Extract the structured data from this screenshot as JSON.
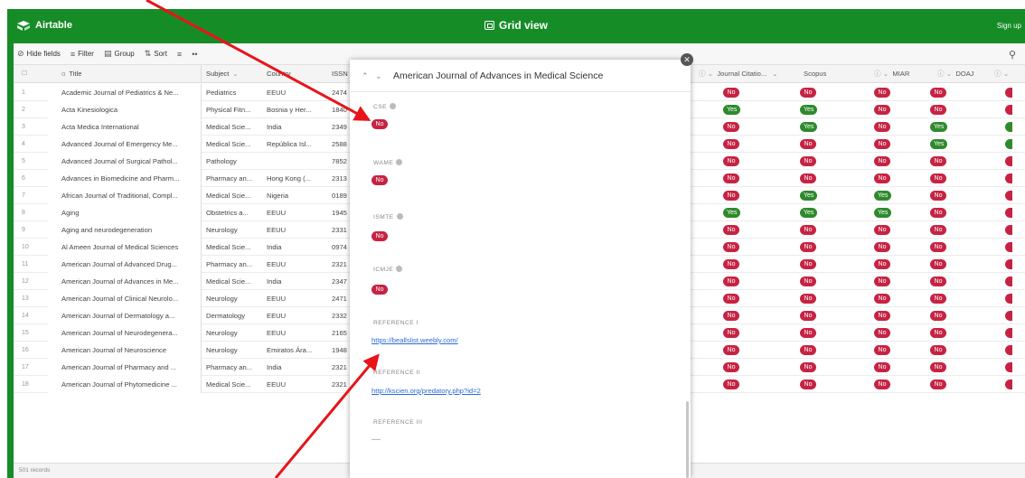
{
  "app": {
    "brand": "Airtable",
    "view_title": "Grid view",
    "signup": "Sign up"
  },
  "toolbar": {
    "hide_fields": "Hide fields",
    "filter": "Filter",
    "group": "Group",
    "sort": "Sort",
    "more": "≡",
    "ellipsis": "••"
  },
  "grid": {
    "headers": {
      "title": "Title",
      "subject": "Subject",
      "country": "Country",
      "issn": "ISSN",
      "journal_citation": "Journal Citatio...",
      "scopus": "Scopus",
      "miar": "MIAR",
      "doaj": "DOAJ"
    },
    "rows": [
      {
        "num": "1",
        "title": "Academic Journal of Pediatrics & Ne...",
        "subject": "Pediatrics",
        "country": "EEUU",
        "issn": "2474",
        "jc": "No",
        "scopus": "No",
        "miar": "No",
        "doaj": "No"
      },
      {
        "num": "2",
        "title": "Acta Kinesiologica",
        "subject": "Physical Fitn...",
        "country": "Bosnia y Her...",
        "issn": "1840",
        "jc": "Yes",
        "scopus": "Yes",
        "miar": "No",
        "doaj": "No"
      },
      {
        "num": "3",
        "title": "Acta Medica International",
        "subject": "Medical Scie...",
        "country": "India",
        "issn": "2349",
        "jc": "No",
        "scopus": "Yes",
        "miar": "No",
        "doaj": "Yes"
      },
      {
        "num": "4",
        "title": "Advanced Journal of Emergency Me...",
        "subject": "Medical Scie...",
        "country": "República Isl...",
        "issn": "2588",
        "jc": "No",
        "scopus": "No",
        "miar": "No",
        "doaj": "Yes"
      },
      {
        "num": "5",
        "title": "Advanced Journal of Surgical Pathol...",
        "subject": "Pathology",
        "country": "",
        "issn": "7852",
        "jc": "No",
        "scopus": "No",
        "miar": "No",
        "doaj": "No"
      },
      {
        "num": "6",
        "title": "Advances in Biomedicine and Pharm...",
        "subject": "Pharmacy an...",
        "country": "Hong Kong (...",
        "issn": "2313",
        "jc": "No",
        "scopus": "No",
        "miar": "No",
        "doaj": "No"
      },
      {
        "num": "7",
        "title": "African Journal of Traditional, Compl...",
        "subject": "Medical Scie...",
        "country": "Nigeria",
        "issn": "0189",
        "jc": "No",
        "scopus": "Yes",
        "miar": "Yes",
        "doaj": "No"
      },
      {
        "num": "8",
        "title": "Aging",
        "subject": "Obstetrics a...",
        "country": "EEUU",
        "issn": "1945",
        "jc": "Yes",
        "scopus": "Yes",
        "miar": "Yes",
        "doaj": "No"
      },
      {
        "num": "9",
        "title": "Aging and neurodegeneration",
        "subject": "Neurology",
        "country": "EEUU",
        "issn": "2331",
        "jc": "No",
        "scopus": "No",
        "miar": "No",
        "doaj": "No"
      },
      {
        "num": "10",
        "title": "Al Ameen Journal of Medical Sciences",
        "subject": "Medical Scie...",
        "country": "India",
        "issn": "0974",
        "jc": "No",
        "scopus": "No",
        "miar": "No",
        "doaj": "No"
      },
      {
        "num": "11",
        "title": "American Journal of Advanced Drug...",
        "subject": "Pharmacy an...",
        "country": "EEUU",
        "issn": "2321",
        "jc": "No",
        "scopus": "No",
        "miar": "No",
        "doaj": "No"
      },
      {
        "num": "12",
        "title": "American Journal of Advances in Me...",
        "subject": "Medical Scie...",
        "country": "India",
        "issn": "2347",
        "jc": "No",
        "scopus": "No",
        "miar": "No",
        "doaj": "No"
      },
      {
        "num": "13",
        "title": "American Journal of Clinical Neurolo...",
        "subject": "Neurology",
        "country": "EEUU",
        "issn": "2471",
        "jc": "No",
        "scopus": "No",
        "miar": "No",
        "doaj": "No"
      },
      {
        "num": "14",
        "title": "American Journal of Dermatology a...",
        "subject": "Dermatology",
        "country": "EEUU",
        "issn": "2332",
        "jc": "No",
        "scopus": "No",
        "miar": "No",
        "doaj": "No"
      },
      {
        "num": "15",
        "title": "American Journal of Neurodegenera...",
        "subject": "Neurology",
        "country": "EEUU",
        "issn": "2165",
        "jc": "No",
        "scopus": "No",
        "miar": "No",
        "doaj": "No"
      },
      {
        "num": "16",
        "title": "American Journal of Neuroscience",
        "subject": "Neurology",
        "country": "Emiratos Ára...",
        "issn": "1948",
        "jc": "No",
        "scopus": "No",
        "miar": "No",
        "doaj": "No"
      },
      {
        "num": "17",
        "title": "American Journal of Pharmacy and ...",
        "subject": "Pharmacy an...",
        "country": "India",
        "issn": "2321",
        "jc": "No",
        "scopus": "No",
        "miar": "No",
        "doaj": "No"
      },
      {
        "num": "18",
        "title": "American Journal of Phytomedicine ...",
        "subject": "Medical Scie...",
        "country": "EEUU",
        "issn": "2321",
        "jc": "No",
        "scopus": "No",
        "miar": "No",
        "doaj": "No"
      }
    ],
    "record_count": "501 records"
  },
  "modal": {
    "title": "American Journal of Advances in Medical Science",
    "fields": [
      {
        "label": "CSE",
        "value": "No"
      },
      {
        "label": "WAME",
        "value": "No"
      },
      {
        "label": "ISMTE",
        "value": "No"
      },
      {
        "label": "ICMJE",
        "value": "No"
      }
    ],
    "reference_1_label": "REFERENCE I",
    "reference_1_value": "https://beallslist.weebly.com/",
    "reference_2_label": "REFERENCE II",
    "reference_2_value": "http://kscien.org/predatory.php?id=2",
    "reference_3_label": "REFERENCE III"
  },
  "colors": {
    "brand_green": "#168c27",
    "no_pill": "#c62343",
    "yes_pill": "#2f8a2d",
    "link": "#2d6bd6",
    "annotation_arrow": "#e8141a"
  }
}
